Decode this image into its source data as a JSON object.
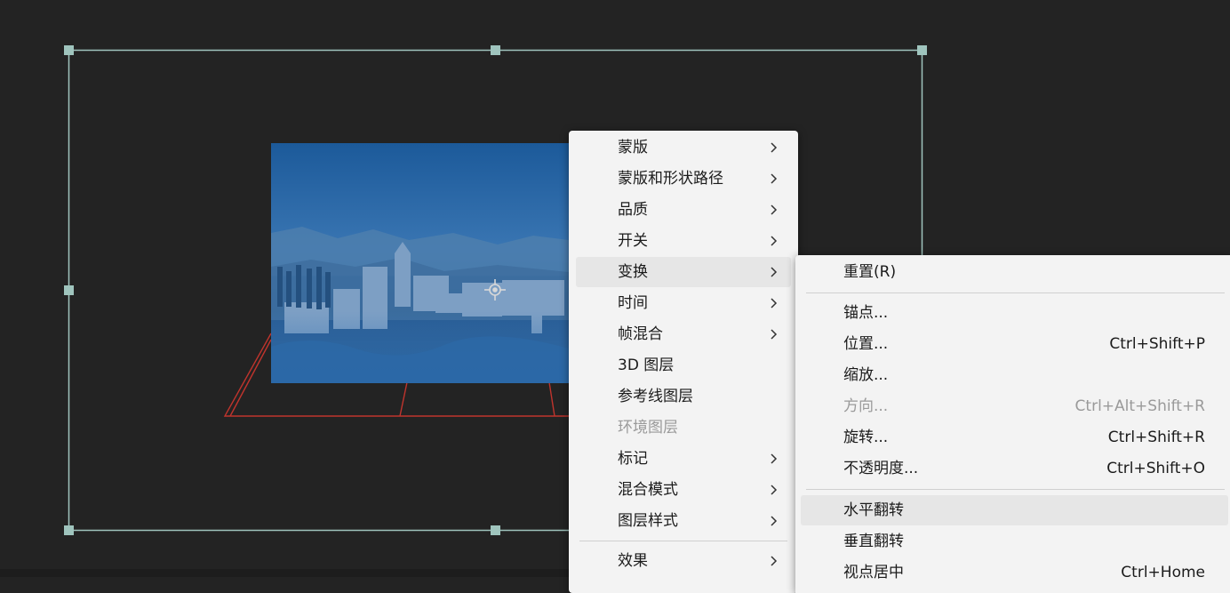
{
  "context_menu": {
    "items": [
      {
        "label": "蒙版",
        "submenu": true
      },
      {
        "label": "蒙版和形状路径",
        "submenu": true
      },
      {
        "label": "品质",
        "submenu": true
      },
      {
        "label": "开关",
        "submenu": true
      },
      {
        "label": "变换",
        "submenu": true,
        "highlighted": true
      },
      {
        "label": "时间",
        "submenu": true
      },
      {
        "label": "帧混合",
        "submenu": true
      },
      {
        "label": "3D 图层",
        "submenu": false
      },
      {
        "label": "参考线图层",
        "submenu": false
      },
      {
        "label": "环境图层",
        "submenu": false,
        "disabled": true
      },
      {
        "label": "标记",
        "submenu": true
      },
      {
        "label": "混合模式",
        "submenu": true
      },
      {
        "label": "图层样式",
        "submenu": true
      },
      {
        "label": "效果",
        "submenu": true
      }
    ]
  },
  "transform_submenu": {
    "items": [
      {
        "label": "重置(R)",
        "shortcut": ""
      },
      {
        "label": "锚点...",
        "shortcut": ""
      },
      {
        "label": "位置...",
        "shortcut": "Ctrl+Shift+P"
      },
      {
        "label": "缩放...",
        "shortcut": ""
      },
      {
        "label": "方向...",
        "shortcut": "Ctrl+Alt+Shift+R",
        "disabled": true
      },
      {
        "label": "旋转...",
        "shortcut": "Ctrl+Shift+R"
      },
      {
        "label": "不透明度...",
        "shortcut": "Ctrl+Shift+O"
      },
      {
        "label": "水平翻转",
        "shortcut": "",
        "highlighted": true
      },
      {
        "label": "垂直翻转",
        "shortcut": ""
      },
      {
        "label": "视点居中",
        "shortcut": "Ctrl+Home"
      }
    ]
  },
  "colors": {
    "canvas_bg": "#232323",
    "bounding_box": "#9fc4bd",
    "grid_lines": "#c0342d",
    "menu_bg": "#f3f3f3",
    "highlight": "#e6e6e6"
  }
}
